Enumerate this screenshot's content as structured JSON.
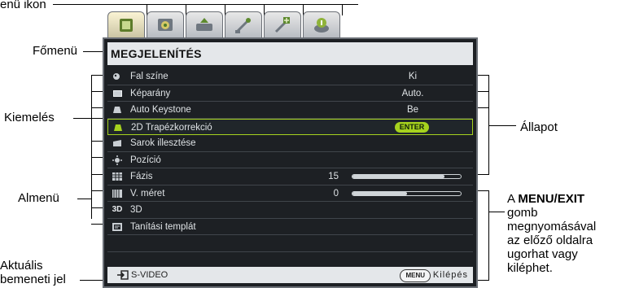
{
  "annotations": {
    "menu_icon": "enü ikon",
    "main_menu": "Főmenü",
    "highlight": "Kiemelés",
    "status": "Állapot",
    "submenu": "Almenü",
    "input_line1": "Aktuális",
    "input_line2": "bemeneti jel",
    "exit_note_prefix": "A ",
    "exit_note_bold": "MENU/EXIT",
    "exit_note_lines": [
      "gomb",
      "megnyomásával",
      "az előző oldalra",
      "ugorhat vagy",
      "kiléphet."
    ]
  },
  "tabs": [
    {
      "icon": "display-tab-icon",
      "active": true
    },
    {
      "icon": "picture-tab-icon"
    },
    {
      "icon": "source-tab-icon"
    },
    {
      "icon": "system-setup-basic-tab-icon"
    },
    {
      "icon": "system-setup-advanced-tab-icon"
    },
    {
      "icon": "information-tab-icon"
    }
  ],
  "menu": {
    "title": "MEGJELENÍTÉS",
    "rows": [
      {
        "label": "Fal színe",
        "value": "Ki",
        "icon": "wall-color-icon"
      },
      {
        "label": "Képarány",
        "value": "Auto.",
        "icon": "aspect-ratio-icon"
      },
      {
        "label": "Auto Keystone",
        "value": "Be",
        "icon": "auto-keystone-icon"
      },
      {
        "label": "2D Trapézkorrekció",
        "button": "ENTER",
        "icon": "keystone-2d-icon",
        "highlighted": true
      },
      {
        "label": "Sarok illesztése",
        "icon": "corner-fit-icon"
      },
      {
        "label": "Pozíció",
        "icon": "position-icon"
      },
      {
        "label": "Fázis",
        "number": "15",
        "level": 0.85,
        "icon": "phase-icon"
      },
      {
        "label": "V. méret",
        "number": "0",
        "level": 0.5,
        "icon": "h-size-icon"
      },
      {
        "label": "3D",
        "icon": "3d-icon"
      },
      {
        "label": "Tanítási templát",
        "icon": "teaching-template-icon"
      }
    ]
  },
  "footer": {
    "source": "S-VIDEO",
    "menu_key": "MENU",
    "exit_label": "Kilépés"
  },
  "colors": {
    "accent": "#a6d21e",
    "osd_bg": "#1d2024",
    "header_bg": "#e4e7ea"
  }
}
